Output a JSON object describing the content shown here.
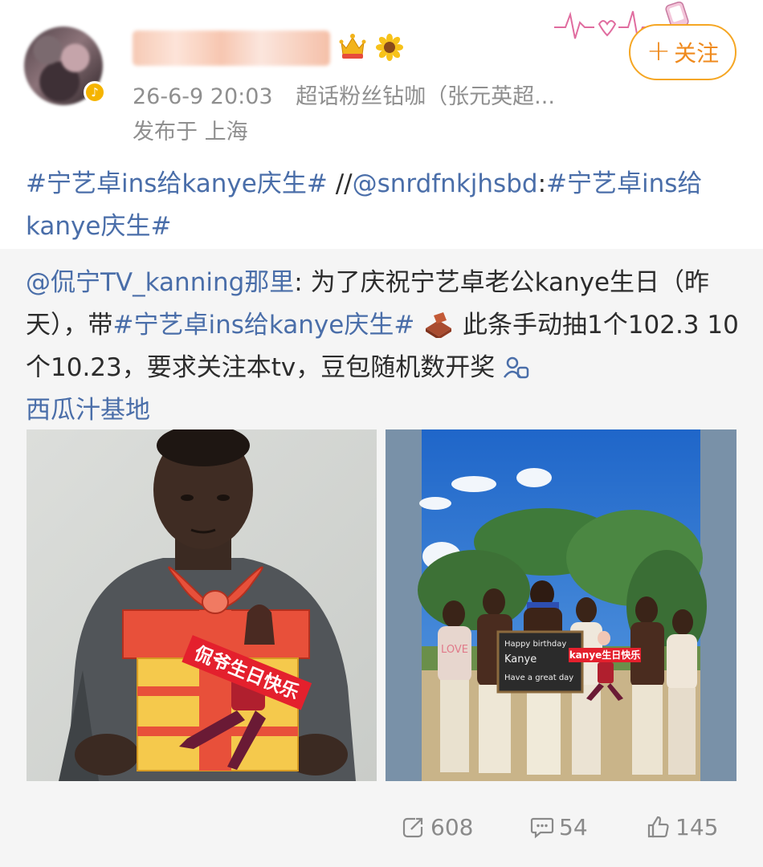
{
  "post": {
    "time": "26-6-9 20:03",
    "source": "超话粉丝钻咖（张元英超...",
    "location": "发布于 上海",
    "follow_label": "关注",
    "follow_plus": "+",
    "hashtag_main": "#宁艺卓ins给kanye庆生#",
    "repost_sep": " //",
    "repost_user": "@snrdfnkjhsbd",
    "repost_colon": ":",
    "repost_hashtag": "#宁艺卓ins给kanye庆生#"
  },
  "original": {
    "author": "@侃宁TV_kanning那里",
    "text_1": ": 为了庆祝宁艺卓老公kanye生日（昨天），带",
    "hashtag": "#宁艺卓ins给kanye庆生#",
    "text_2": " 此条手动抽1个102.3 10个10.23，要求关注本tv，豆包随机数开奖 ",
    "supertopic": "西瓜汁基地"
  },
  "media": {
    "left_caption": "侃爷生日快乐",
    "right_board_lines": [
      "Happy birthday",
      "Kanye",
      "Have a great day"
    ],
    "right_caption": "kanye生日快乐",
    "right_shirt_text": "LOVE"
  },
  "stats": {
    "reposts": "608",
    "comments": "54",
    "likes": "145"
  },
  "colors": {
    "link": "#4a6ea9",
    "follow": "#ef8a1d",
    "quoted_bg": "#f5f5f5"
  },
  "icons": [
    "vip-crown-icon",
    "sunflower-icon",
    "verified-badge-icon",
    "brick-icon",
    "supertopic-icon",
    "repost-icon",
    "comment-icon",
    "like-icon"
  ]
}
